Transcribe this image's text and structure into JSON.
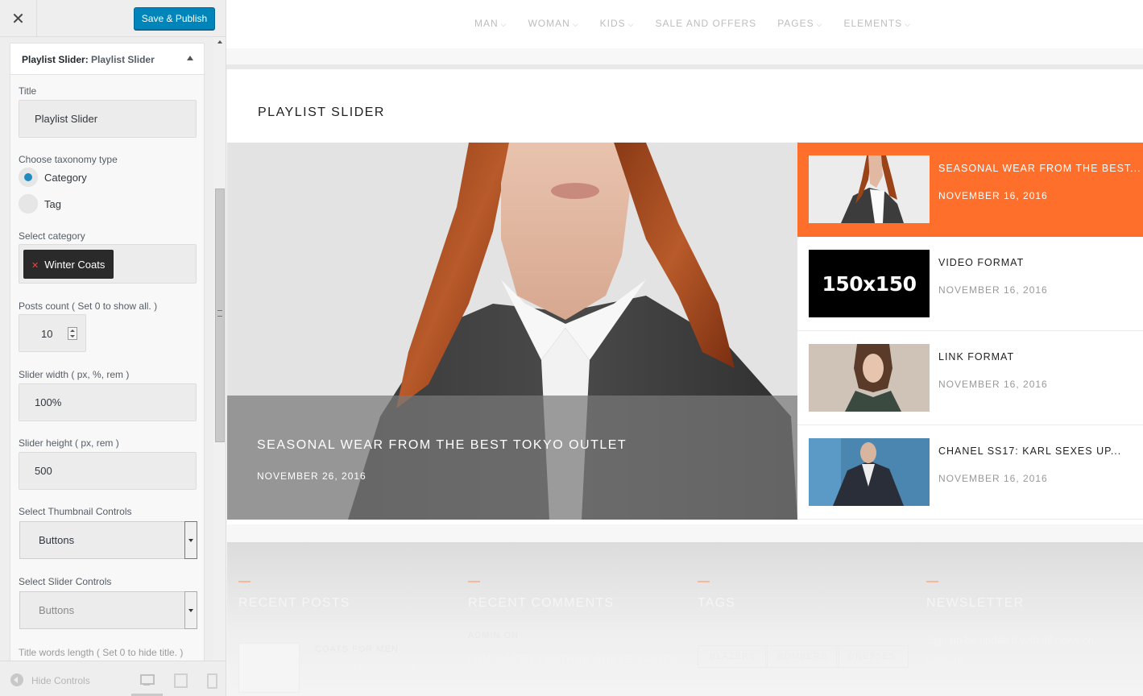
{
  "customizer": {
    "close_glyph": "✕",
    "save_label": "Save & Publish",
    "section_title_bold": "Playlist Slider:",
    "section_title_name": "Playlist Slider",
    "title_label": "Title",
    "title_value": "Playlist Slider",
    "taxonomy_label": "Choose taxonomy type",
    "taxonomy_options": [
      "Category",
      "Tag"
    ],
    "taxonomy_selected": "Category",
    "category_label": "Select category",
    "category_chip": "Winter Coats",
    "posts_label": "Posts count ( Set 0 to show all. )",
    "posts_value": "10",
    "width_label": "Slider width ( px, %, rem )",
    "width_value": "100%",
    "height_label": "Slider height ( px, rem )",
    "height_value": "500",
    "thumb_controls_label": "Select Thumbnail Controls",
    "thumb_controls_value": "Buttons",
    "slider_controls_label": "Select Slider Controls",
    "slider_controls_value": "Buttons",
    "title_words_label": "Title words length ( Set 0 to hide title. )",
    "hide_controls_label": "Hide Controls"
  },
  "preview": {
    "nav": [
      "MAN",
      "WOMAN",
      "KIDS",
      "SALE AND OFFERS",
      "PAGES",
      "ELEMENTS"
    ],
    "nav_dropdowns": [
      true,
      true,
      true,
      false,
      true,
      true
    ],
    "widget_title": "PLAYLIST SLIDER",
    "hero": {
      "title": "SEASONAL WEAR FROM THE BEST TOKYO OUTLET",
      "date": "NOVEMBER 26, 2016"
    },
    "playlist": [
      {
        "title": "SEASONAL WEAR FROM THE BEST...",
        "date": "NOVEMBER 16, 2016",
        "active": true
      },
      {
        "title": "VIDEO FORMAT",
        "date": "NOVEMBER 16, 2016",
        "active": false
      },
      {
        "title": "LINK FORMAT",
        "date": "NOVEMBER 16, 2016",
        "active": false
      },
      {
        "title": "CHANEL SS17: KARL SEXES UP...",
        "date": "NOVEMBER 16, 2016",
        "active": false
      }
    ],
    "placeholder_thumb_text": "150x150",
    "footer": {
      "recent_posts_title": "RECENT POSTS",
      "recent_post_category": "COATS FOR MEN",
      "recent_post_title": "WHAT TO WEAR THIS...",
      "recent_comments_title": "RECENT COMMENTS",
      "comment_author": "ADMIN ON",
      "comment_post": "LAMINATED LEATHER ANKLE BOOTS",
      "tags_title": "TAGS",
      "tags": [
        "BLAZERS",
        "BOMBERS",
        "DRESSES"
      ],
      "newsletter_title": "NEWSLETTER",
      "newsletter_text_1": "Sign up be updated with all news on",
      "newsletter_text_2": "fashion!"
    }
  },
  "colors": {
    "accent_orange": "#ff6f2c",
    "wp_blue": "#0085ba",
    "radio_blue": "#1e8cbe"
  }
}
